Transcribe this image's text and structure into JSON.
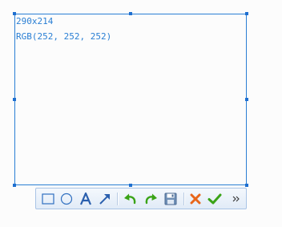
{
  "selection": {
    "size_label": "290x214",
    "rgb_label": "RGB(252, 252, 252)"
  },
  "toolbar": {
    "tools": [
      {
        "name": "rectangle-tool",
        "icon": "rectangle-icon"
      },
      {
        "name": "ellipse-tool",
        "icon": "ellipse-icon"
      },
      {
        "name": "text-tool",
        "icon": "text-a-icon"
      },
      {
        "name": "arrow-tool",
        "icon": "arrow-icon"
      },
      {
        "name": "undo-button",
        "icon": "undo-icon"
      },
      {
        "name": "redo-button",
        "icon": "redo-icon"
      },
      {
        "name": "save-button",
        "icon": "floppy-save-icon"
      },
      {
        "name": "cancel-button",
        "icon": "close-x-icon"
      },
      {
        "name": "confirm-button",
        "icon": "checkmark-icon"
      },
      {
        "name": "more-button",
        "icon": "chevron-more-icon"
      }
    ]
  },
  "colors": {
    "selection_border": "#2a7fd4",
    "handle": "#1e6fd0",
    "background": "#fcfcfc",
    "icon_blue": "#2f6fc0",
    "icon_green": "#3aa317",
    "icon_orange": "#e8661a"
  }
}
